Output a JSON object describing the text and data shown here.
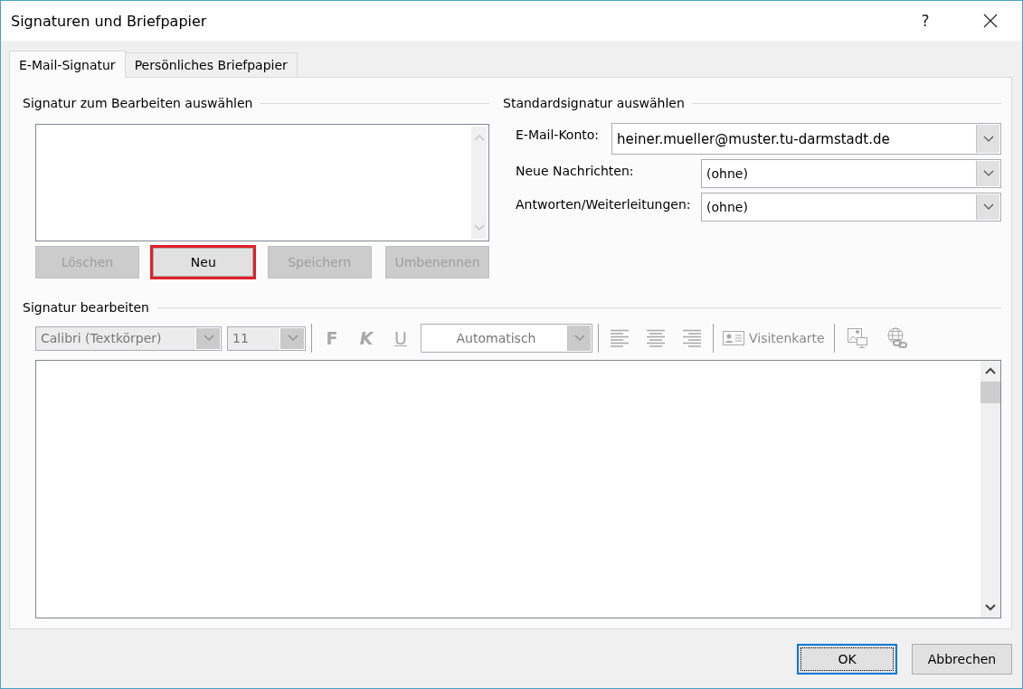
{
  "window": {
    "title": "Signaturen und Briefpapier",
    "help": "?"
  },
  "tabs": [
    {
      "label": "E-Mail-Signatur",
      "selected": true
    },
    {
      "label": "Persönliches Briefpapier",
      "selected": false
    }
  ],
  "select_signature": {
    "title": "Signatur zum Bearbeiten auswählen",
    "buttons": [
      {
        "label": "Löschen",
        "disabled": true,
        "highlighted": false
      },
      {
        "label": "Neu",
        "disabled": false,
        "highlighted": true
      },
      {
        "label": "Speichern",
        "disabled": true,
        "highlighted": false
      },
      {
        "label": "Umbenennen",
        "disabled": true,
        "highlighted": false
      }
    ]
  },
  "default_signature": {
    "title": "Standardsignatur auswählen",
    "fields": [
      {
        "label": "E-Mail-Konto:",
        "value": "heiner.mueller@muster.tu-darmstadt.de",
        "kind": "wide"
      },
      {
        "label": "Neue Nachrichten:",
        "value": "(ohne)",
        "kind": "narrow"
      },
      {
        "label": "Antworten/Weiterleitungen:",
        "value": "(ohne)",
        "kind": "narrow"
      }
    ]
  },
  "edit_signature": {
    "title": "Signatur bearbeiten",
    "toolbar": [
      {
        "items": [
          {
            "kind": "font",
            "value": "Calibri (Textkörper)",
            "disabled": true
          },
          {
            "kind": "size",
            "value": "11",
            "disabled": true
          }
        ]
      },
      {
        "items": [
          {
            "kind": "bold",
            "label": "F",
            "disabled": true
          },
          {
            "kind": "italic",
            "label": "K",
            "disabled": true
          },
          {
            "kind": "underline",
            "label": "U",
            "disabled": true
          },
          {
            "kind": "color",
            "value": "Automatisch",
            "disabled": true
          }
        ]
      },
      {
        "items": [
          {
            "kind": "align_left",
            "disabled": true
          },
          {
            "kind": "align_center",
            "disabled": true
          },
          {
            "kind": "align_right",
            "disabled": true
          }
        ]
      },
      {
        "items": [
          {
            "kind": "card",
            "label": "Visitenkarte",
            "disabled": true
          }
        ]
      },
      {
        "items": [
          {
            "kind": "picture",
            "disabled": true
          },
          {
            "kind": "link",
            "disabled": true
          }
        ]
      }
    ]
  },
  "footer": {
    "buttons": [
      {
        "label": "OK",
        "default": true
      },
      {
        "label": "Abbrechen",
        "default": false
      }
    ]
  }
}
